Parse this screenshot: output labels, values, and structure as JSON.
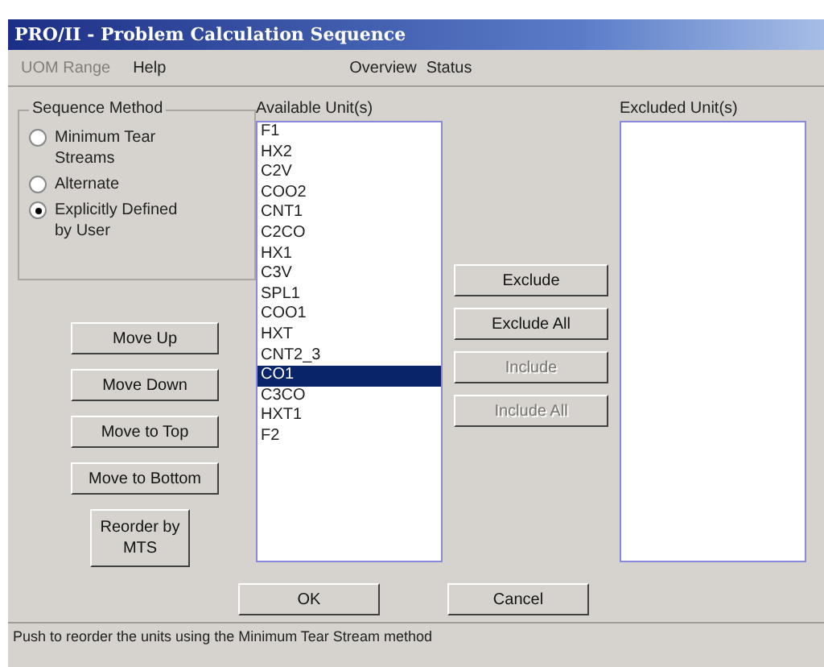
{
  "window": {
    "title": "PRO/II - Problem Calculation Sequence"
  },
  "menu": [
    {
      "label": "UOM Range",
      "disabled": true
    },
    {
      "label": "Help",
      "disabled": false
    }
  ],
  "header_links": [
    "Overview",
    "Status"
  ],
  "sequence_method": {
    "title": "Sequence Method",
    "options": [
      {
        "label": "Minimum Tear Streams",
        "selected": false
      },
      {
        "label": "Alternate",
        "selected": false
      },
      {
        "label": "Explicitly Defined by User",
        "selected": true
      }
    ]
  },
  "order_buttons": [
    {
      "label": "Move Up"
    },
    {
      "label": "Move Down"
    },
    {
      "label": "Move to Top"
    },
    {
      "label": "Move to Bottom"
    },
    {
      "label": "Reorder by MTS"
    }
  ],
  "available": {
    "title": "Available Unit(s)",
    "items": [
      {
        "label": "F1",
        "selected": false
      },
      {
        "label": "HX2",
        "selected": false
      },
      {
        "label": "C2V",
        "selected": false
      },
      {
        "label": "COO2",
        "selected": false
      },
      {
        "label": "CNT1",
        "selected": false
      },
      {
        "label": "C2CO",
        "selected": false
      },
      {
        "label": "HX1",
        "selected": false
      },
      {
        "label": "C3V",
        "selected": false
      },
      {
        "label": "SPL1",
        "selected": false
      },
      {
        "label": "COO1",
        "selected": false
      },
      {
        "label": "HXT",
        "selected": false
      },
      {
        "label": "CNT2_3",
        "selected": false
      },
      {
        "label": "CO1",
        "selected": true
      },
      {
        "label": "C3CO",
        "selected": false
      },
      {
        "label": "HXT1",
        "selected": false
      },
      {
        "label": "F2",
        "selected": false
      }
    ]
  },
  "transfer_buttons": [
    {
      "label": "Exclude",
      "disabled": false
    },
    {
      "label": "Exclude All",
      "disabled": false
    },
    {
      "label": "Include",
      "disabled": true
    },
    {
      "label": "Include All",
      "disabled": true
    }
  ],
  "excluded": {
    "title": "Excluded Unit(s)"
  },
  "dialog_buttons": [
    "OK",
    "Cancel"
  ],
  "status_bar": "Push to reorder the units using the Minimum Tear Stream method"
}
